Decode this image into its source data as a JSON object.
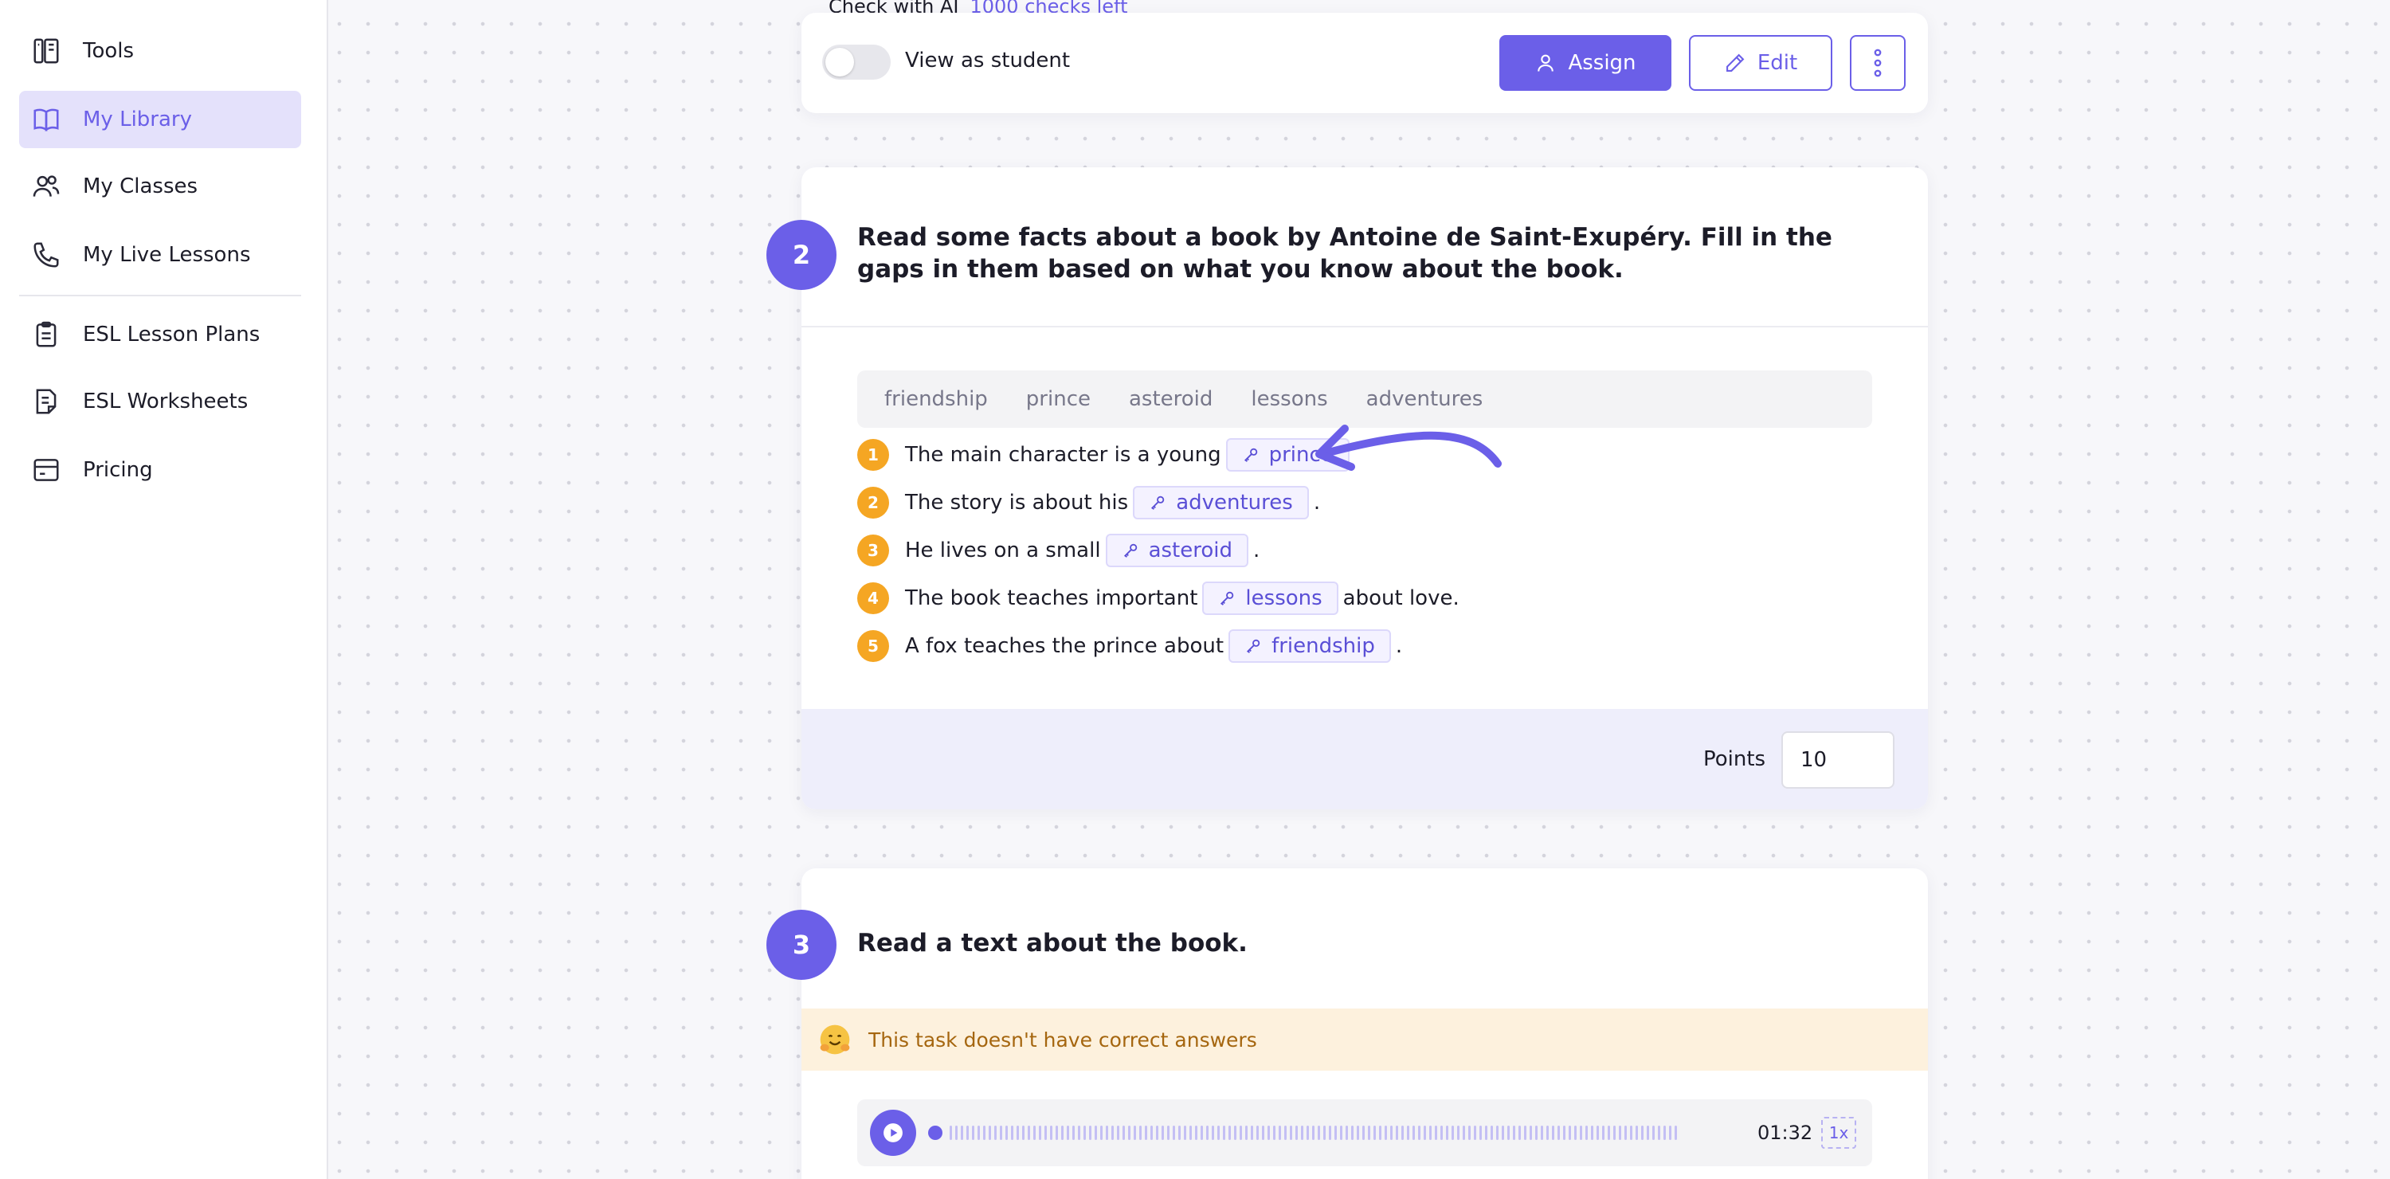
{
  "sidebar": {
    "items": [
      {
        "label": "Tools",
        "icon": "tools-icon"
      },
      {
        "label": "My Library",
        "icon": "book-icon",
        "active": true
      },
      {
        "label": "My Classes",
        "icon": "users-icon"
      },
      {
        "label": "My Live Lessons",
        "icon": "phone-icon"
      },
      {
        "label": "ESL Lesson Plans",
        "icon": "clipboard-icon"
      },
      {
        "label": "ESL Worksheets",
        "icon": "worksheet-icon"
      },
      {
        "label": "Pricing",
        "icon": "card-icon"
      }
    ]
  },
  "toolbar": {
    "check_ai": "Check with AI",
    "checks_left": "1000 checks left",
    "view_as_student": "View as student",
    "assign_label": "Assign",
    "edit_label": "Edit"
  },
  "task2": {
    "number": "2",
    "title": "Read some facts about a book by Antoine de Saint-Exupéry. Fill in the gaps in them based on what you know about the book.",
    "word_bank": [
      "friendship",
      "prince",
      "asteroid",
      "lessons",
      "adventures"
    ],
    "questions": [
      {
        "num": "1",
        "before": "The main character is a young",
        "answer": "prince",
        "after": ""
      },
      {
        "num": "2",
        "before": "The story is about his",
        "answer": "adventures",
        "after": "."
      },
      {
        "num": "3",
        "before": "He lives on a small",
        "answer": "asteroid",
        "after": "."
      },
      {
        "num": "4",
        "before": "The book teaches important",
        "answer": "lessons",
        "after": "about love."
      },
      {
        "num": "5",
        "before": "A fox teaches the prince about",
        "answer": "friendship",
        "after": "."
      }
    ],
    "points_label": "Points",
    "points_value": "10"
  },
  "task3": {
    "number": "3",
    "title": "Read a text about the book.",
    "notice": "This task doesn't have correct answers",
    "audio_time": "01:32",
    "audio_speed": "1x"
  },
  "colors": {
    "accent": "#6b5fe8",
    "active_bg": "#e4e1fb",
    "number_badge": "#f5a623",
    "notice_bg": "#fdf1dd",
    "notice_text": "#a5660f"
  }
}
